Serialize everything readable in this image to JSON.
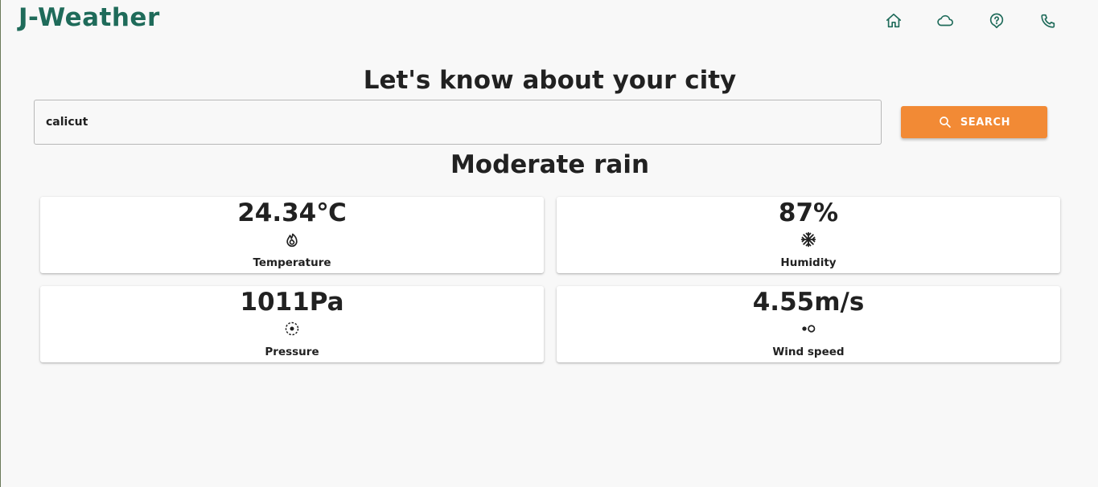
{
  "brand": "J-Weather",
  "nav": {
    "home_icon": "home-icon",
    "cloud_icon": "cloud-icon",
    "help_icon": "help-icon",
    "phone_icon": "phone-icon"
  },
  "heading": "Let's know about your city",
  "search": {
    "value": "calicut",
    "button_label": "SEARCH",
    "button_color": "#f28a35"
  },
  "condition": "Moderate rain",
  "cards": [
    {
      "value": "24.34℃",
      "label": "Temperature",
      "icon": "fire-icon"
    },
    {
      "value": "87%",
      "label": "Humidity",
      "icon": "snowflake-icon"
    },
    {
      "value": "1011Pa",
      "label": "Pressure",
      "icon": "pressure-icon"
    },
    {
      "value": "4.55m/s",
      "label": "Wind speed",
      "icon": "wind-icon"
    }
  ],
  "colors": {
    "brand": "#1f6b5a",
    "accent": "#f28a35",
    "background": "#f8f8f8"
  }
}
